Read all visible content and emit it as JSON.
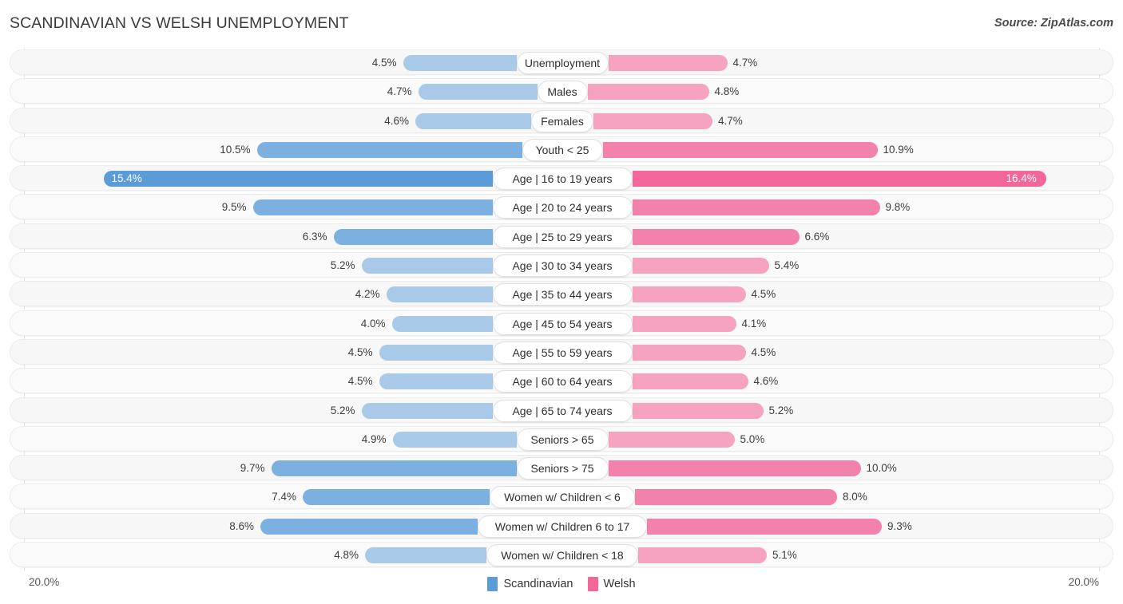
{
  "header": {
    "title": "SCANDINAVIAN VS WELSH UNEMPLOYMENT",
    "source": "Source: ZipAtlas.com"
  },
  "axis": {
    "left_label": "20.0%",
    "right_label": "20.0%",
    "max": 20.0
  },
  "legend": {
    "items": [
      {
        "label": "Scandinavian",
        "color": "#5b9bd8"
      },
      {
        "label": "Welsh",
        "color": "#f2669a"
      }
    ]
  },
  "colors": {
    "blue_light": "#a9c9e8",
    "blue_mid": "#7bb0e0",
    "blue_high": "#5b9bd8",
    "pink_light": "#f5a3c0",
    "pink_mid": "#f281ab",
    "pink_high": "#f2669a",
    "row_bg": "#f7f7f7"
  },
  "chart_data": {
    "type": "bar",
    "orientation": "horizontal-diverging",
    "title": "SCANDINAVIAN VS WELSH UNEMPLOYMENT",
    "xlabel": "",
    "ylabel": "",
    "xlim": [
      0,
      20.0
    ],
    "grid": true,
    "legend_position": "bottom-center",
    "categories": [
      "Unemployment",
      "Males",
      "Females",
      "Youth < 25",
      "Age | 16 to 19 years",
      "Age | 20 to 24 years",
      "Age | 25 to 29 years",
      "Age | 30 to 34 years",
      "Age | 35 to 44 years",
      "Age | 45 to 54 years",
      "Age | 55 to 59 years",
      "Age | 60 to 64 years",
      "Age | 65 to 74 years",
      "Seniors > 65",
      "Seniors > 75",
      "Women w/ Children < 6",
      "Women w/ Children 6 to 17",
      "Women w/ Children < 18"
    ],
    "series": [
      {
        "name": "Scandinavian",
        "color": "#5b9bd8",
        "values": [
          4.5,
          4.7,
          4.6,
          10.5,
          15.4,
          9.5,
          6.3,
          5.2,
          4.2,
          4.0,
          4.5,
          4.5,
          5.2,
          4.9,
          9.7,
          7.4,
          8.6,
          4.8
        ],
        "labels": [
          "4.5%",
          "4.7%",
          "4.6%",
          "10.5%",
          "15.4%",
          "9.5%",
          "6.3%",
          "5.2%",
          "4.2%",
          "4.0%",
          "4.5%",
          "4.5%",
          "5.2%",
          "4.9%",
          "9.7%",
          "7.4%",
          "8.6%",
          "4.8%"
        ]
      },
      {
        "name": "Welsh",
        "color": "#f2669a",
        "values": [
          4.7,
          4.8,
          4.7,
          10.9,
          16.4,
          9.8,
          6.6,
          5.4,
          4.5,
          4.1,
          4.5,
          4.6,
          5.2,
          5.0,
          10.0,
          8.0,
          9.3,
          5.1
        ],
        "labels": [
          "4.7%",
          "4.8%",
          "4.7%",
          "10.9%",
          "16.4%",
          "9.8%",
          "6.6%",
          "5.4%",
          "4.5%",
          "4.1%",
          "4.5%",
          "4.6%",
          "5.2%",
          "5.0%",
          "10.0%",
          "8.0%",
          "9.3%",
          "5.1%"
        ]
      }
    ]
  }
}
